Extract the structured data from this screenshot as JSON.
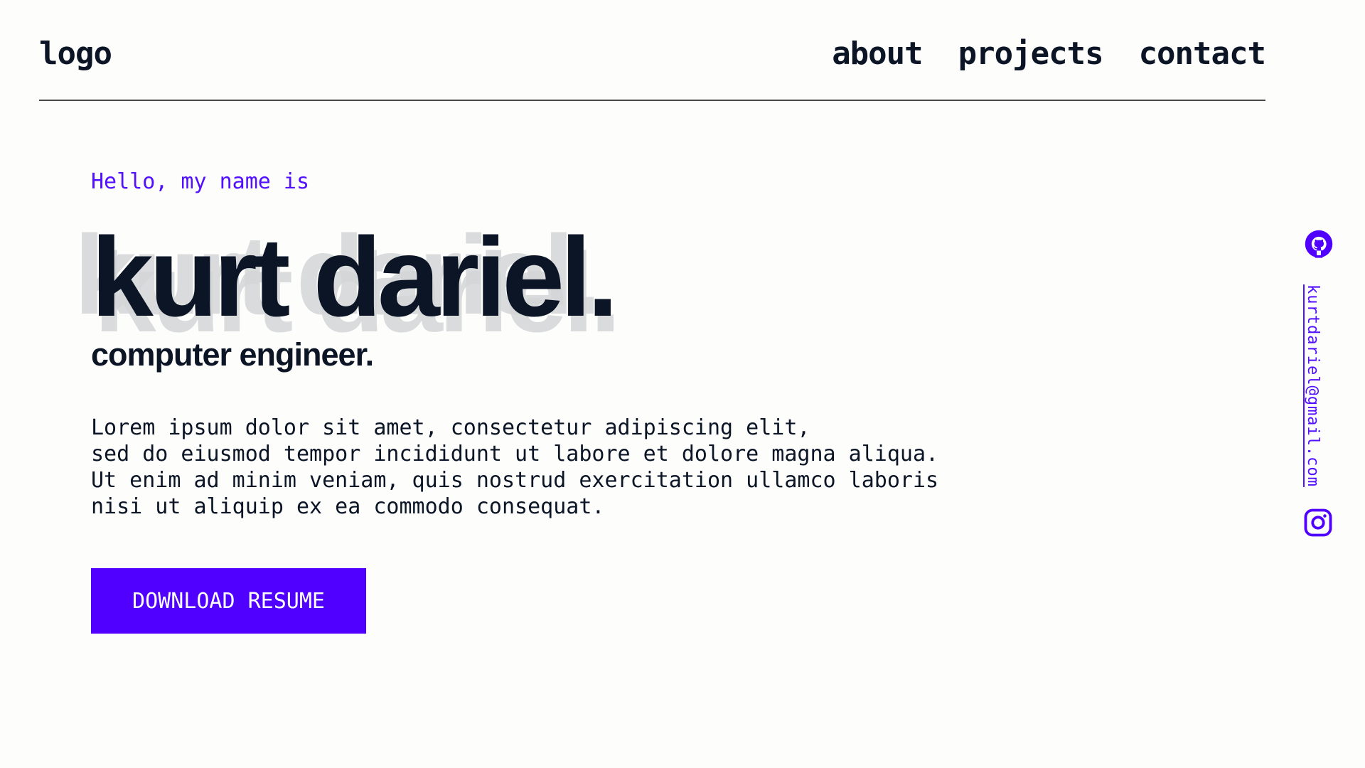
{
  "header": {
    "logo": "logo",
    "nav": [
      {
        "label": "about"
      },
      {
        "label": "projects"
      },
      {
        "label": "contact"
      }
    ]
  },
  "hero": {
    "greeting": "Hello, my name is",
    "name": "kurt dariel.",
    "role": "computer engineer.",
    "bio": "Lorem ipsum dolor sit amet, consectetur adipiscing elit,\nsed do eiusmod tempor incididunt ut labore et dolore magna aliqua.\nUt enim ad minim veniam, quis nostrud exercitation ullamco laboris\nnisi ut aliquip ex ea commodo consequat.",
    "cta_label": "DOWNLOAD RESUME"
  },
  "social": {
    "github_icon": "github-icon",
    "email": "kurtdariel@gmail.com",
    "instagram_icon": "instagram-icon"
  },
  "colors": {
    "accent": "#5000ff",
    "text": "#0b1526",
    "background": "#fdfdfc",
    "shadow_text": "#d4d6d8"
  }
}
